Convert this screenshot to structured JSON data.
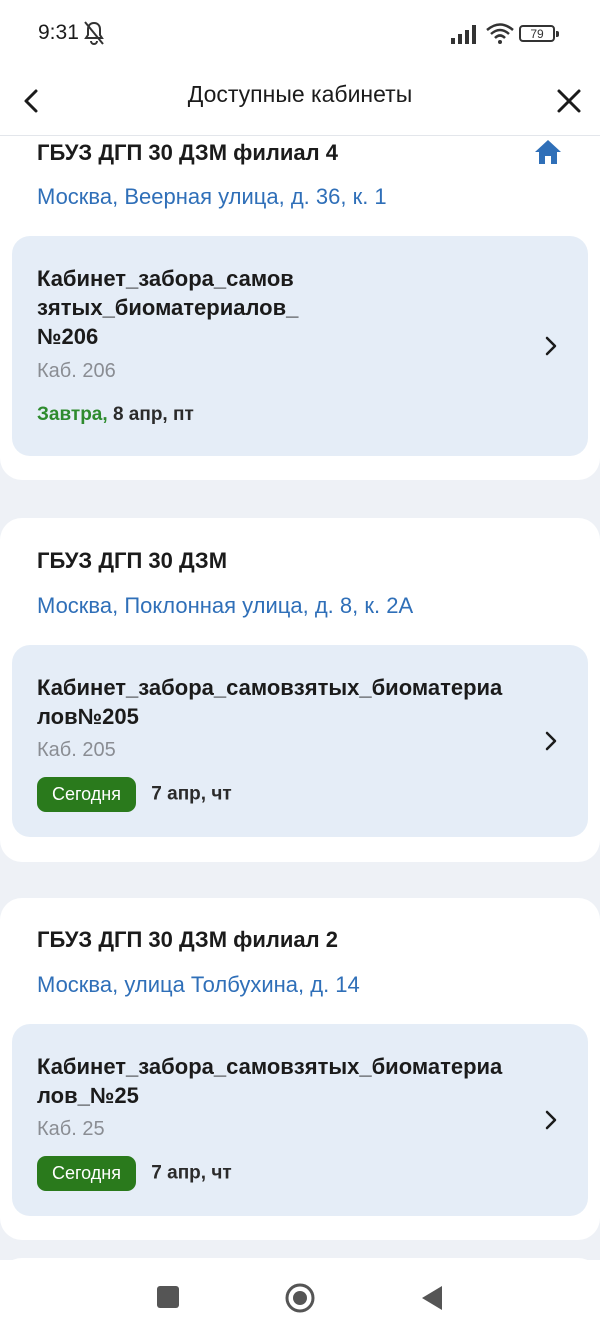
{
  "status_bar": {
    "time": "9:31",
    "battery": "79"
  },
  "header": {
    "title": "Доступные кабинеты"
  },
  "groups": [
    {
      "clinic": "ГБУЗ ДГП 30 ДЗМ филиал 4",
      "address": "Москва, Веерная улица, д. 36, к. 1",
      "room": {
        "name_lines": [
          "Кабинет_забора_самов",
          "зятых_биоматериалов_",
          "№206"
        ],
        "number": "Каб. 206",
        "day_label": "Завтра,",
        "date": "8 апр, пт"
      }
    },
    {
      "clinic": "ГБУЗ ДГП 30 ДЗМ",
      "address": "Москва, Поклонная улица, д. 8, к. 2А",
      "room": {
        "name_lines": [
          "Кабинет_забора_самовзятых_биоматериа",
          "лов№205"
        ],
        "number": "Каб. 205",
        "badge": "Сегодня",
        "date": "7 апр, чт"
      }
    },
    {
      "clinic": "ГБУЗ ДГП 30 ДЗМ филиал 2",
      "address": "Москва, улица Толбухина, д. 14",
      "room": {
        "name_lines": [
          "Кабинет_забора_самовзятых_биоматериа",
          "лов_№25"
        ],
        "number": "Каб. 25",
        "badge": "Сегодня",
        "date": "7 апр, чт"
      }
    }
  ],
  "colors": {
    "link": "#2f6fb8",
    "today_badge": "#2a7a1c",
    "tomorrow_text": "#2e8b2e",
    "card_bg": "#e5edf7",
    "page_bg": "#eef1f6"
  },
  "icons": {
    "back": "chevron-left-icon",
    "close": "close-icon",
    "home": "home-icon",
    "row": "chevron-right-icon"
  }
}
